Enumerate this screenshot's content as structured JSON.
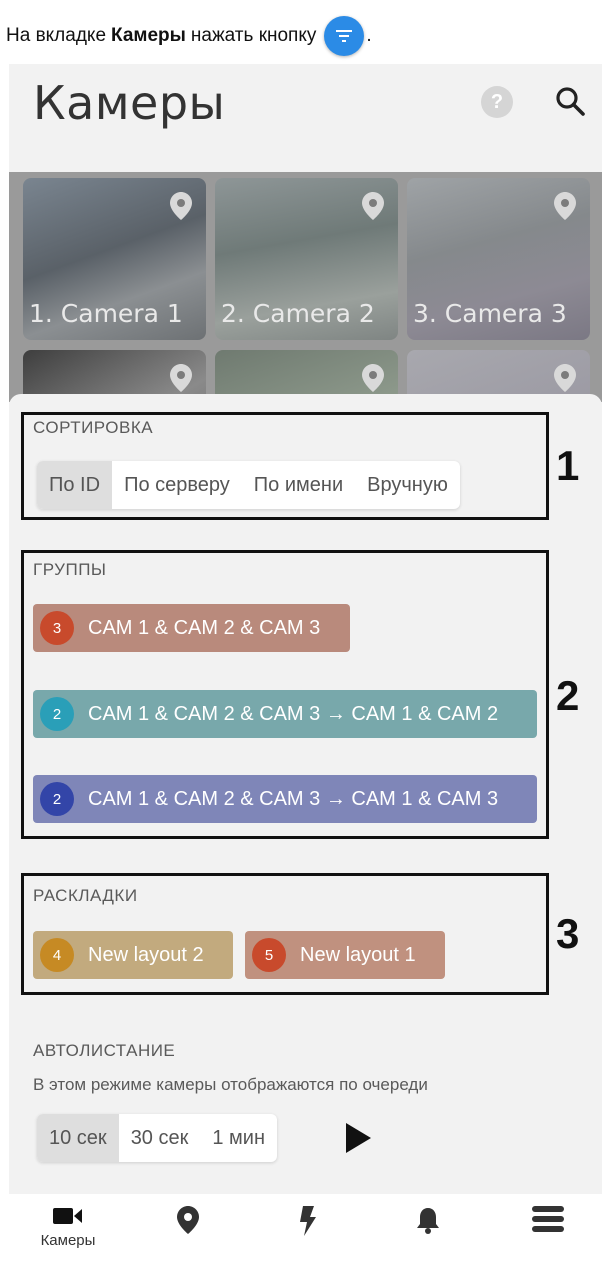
{
  "caption": {
    "before": "На вкладке",
    "bold": "Камеры",
    "after": "нажать кнопку",
    "end": "."
  },
  "header": {
    "title": "Камеры",
    "help_glyph": "?"
  },
  "cameras": [
    {
      "label": "1. Camera 1"
    },
    {
      "label": "2. Camera 2"
    },
    {
      "label": "3. Camera 3"
    }
  ],
  "sorting": {
    "title": "СОРТИРОВКА",
    "options": [
      "По ID",
      "По серверу",
      "По имени",
      "Вручную"
    ],
    "selected": "По ID"
  },
  "groups": {
    "title": "ГРУППЫ",
    "items": [
      {
        "count": "3",
        "label": "CAM 1 & CAM 2 & CAM 3",
        "color": "#b98a7c",
        "badge_color": "#c84a2c"
      },
      {
        "count": "2",
        "label": "CAM 1 & CAM 2 & CAM 3 → CAM 1 & CAM 2",
        "color": "#78a8ab",
        "badge_color": "#2a9fb8"
      },
      {
        "count": "2",
        "label": "CAM 1 & CAM 2 & CAM 3 → CAM 1 & CAM 3",
        "color": "#7f86b8",
        "badge_color": "#3345a8"
      }
    ]
  },
  "layouts": {
    "title": "РАСКЛАДКИ",
    "items": [
      {
        "count": "4",
        "label": "New layout 2",
        "color": "#c2aa7e",
        "badge_color": "#c68a24"
      },
      {
        "count": "5",
        "label": "New layout 1",
        "color": "#c0917f",
        "badge_color": "#c84a2c"
      }
    ]
  },
  "annotations": [
    "1",
    "2",
    "3"
  ],
  "autoscroll": {
    "title": "АВТОЛИСТАНИЕ",
    "description": "В этом режиме камеры отображаются по очереди",
    "options": [
      "10 сек",
      "30 сек",
      "1 мин"
    ],
    "selected": "10 сек"
  },
  "nav": {
    "items": [
      {
        "icon": "camera-icon",
        "label": "Камеры"
      },
      {
        "icon": "map-pin-icon",
        "label": ""
      },
      {
        "icon": "lightning-icon",
        "label": ""
      },
      {
        "icon": "bell-icon",
        "label": ""
      },
      {
        "icon": "menu-icon",
        "label": ""
      }
    ]
  },
  "colors": {
    "accent_blue": "#2b8be6",
    "background": "#f2f2f2",
    "annotation_frame": "#111111"
  }
}
